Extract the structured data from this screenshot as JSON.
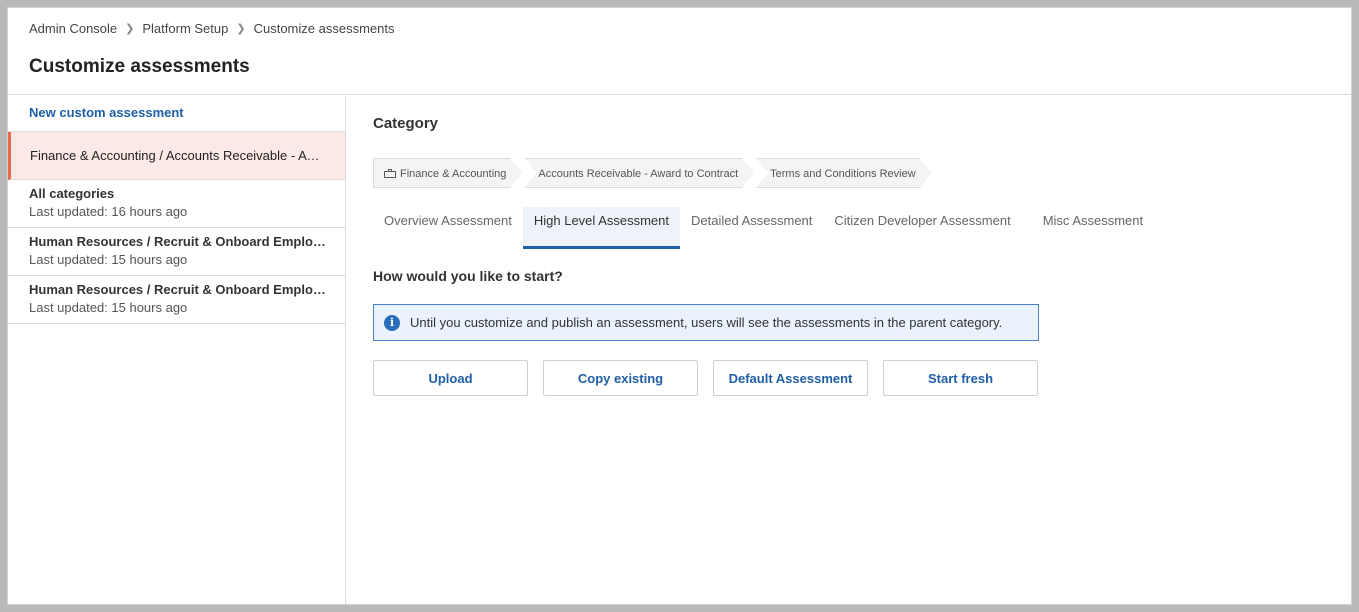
{
  "breadcrumb": [
    "Admin Console",
    "Platform Setup",
    "Customize assessments"
  ],
  "page_title": "Customize assessments",
  "sidebar": {
    "new_link": "New custom assessment",
    "selected": "Finance & Accounting / Accounts Receivable - Award to Contract",
    "items": [
      {
        "title": "All categories",
        "updated": "Last updated: 16 hours ago"
      },
      {
        "title": "Human Resources / Recruit & Onboard Employees",
        "updated": "Last updated: 15 hours ago"
      },
      {
        "title": "Human Resources / Recruit & Onboard Employees",
        "updated": "Last updated: 15 hours ago"
      }
    ]
  },
  "main": {
    "category_heading": "Category",
    "category_path": [
      "Finance & Accounting",
      "Accounts Receivable - Award to Contract",
      "Terms and Conditions Review"
    ],
    "tabs": [
      "Overview Assessment",
      "High Level Assessment",
      "Detailed Assessment",
      "Citizen Developer Assessment",
      "Misc Assessment"
    ],
    "active_tab": "High Level Assessment",
    "start_question": "How would you like to start?",
    "info_message": "Until you customize and publish an assessment, users will see the assessments in the parent category.",
    "buttons": [
      "Upload",
      "Copy existing",
      "Default Assessment",
      "Start fresh"
    ]
  },
  "colors": {
    "accent": "#1f5fa6",
    "selected_bg": "#fbe9e6",
    "selected_border": "#e56b4f",
    "info_bg": "#eaf2fb"
  },
  "icons": {
    "info": "info-icon",
    "category": "briefcase-icon",
    "breadcrumb_separator": "chevron-right-icon"
  }
}
